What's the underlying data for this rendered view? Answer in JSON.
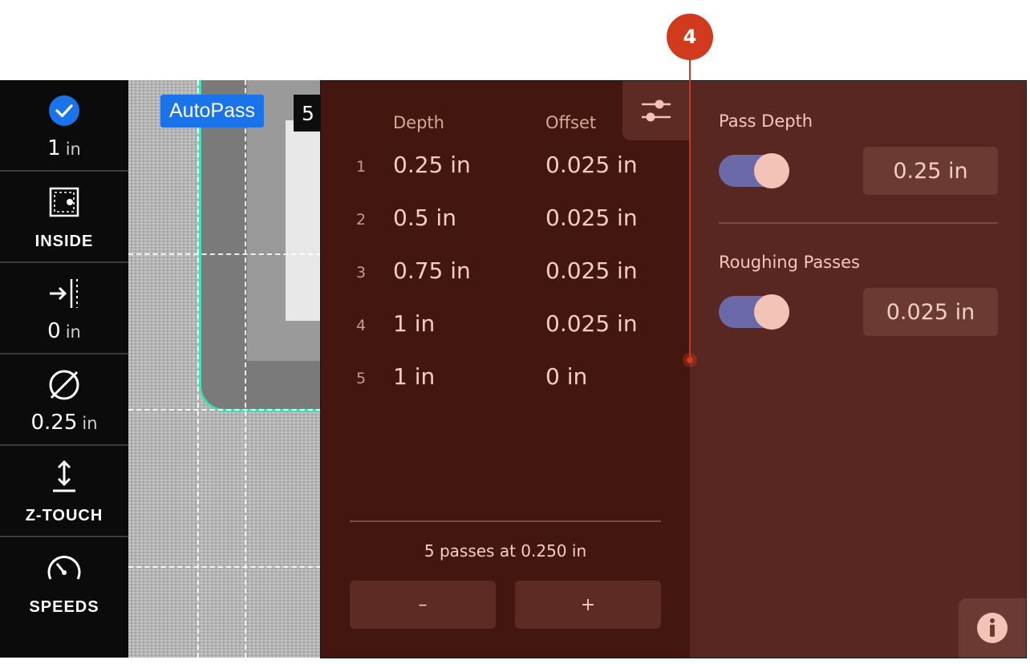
{
  "annotation": {
    "marker": "4"
  },
  "sidebar": {
    "items": [
      {
        "name": "check-status",
        "icon": "check-circle-icon",
        "value": "1",
        "unit": "in"
      },
      {
        "name": "cut-side",
        "icon": "inside-cut-icon",
        "label": "INSIDE"
      },
      {
        "name": "offset",
        "icon": "offset-arrow-icon",
        "value": "0",
        "unit": "in"
      },
      {
        "name": "bit-diameter",
        "icon": "diameter-icon",
        "value": "0.25",
        "unit": "in"
      },
      {
        "name": "z-touch",
        "icon": "z-touch-icon",
        "label": "Z-TOUCH"
      },
      {
        "name": "speeds",
        "icon": "speedometer-icon",
        "label": "SPEEDS"
      }
    ]
  },
  "canvas": {
    "autopass_label": "AutoPass",
    "pass_count": "5"
  },
  "passes": {
    "headers": {
      "depth": "Depth",
      "offset": "Offset"
    },
    "rows": [
      {
        "num": "1",
        "depth": "0.25 in",
        "offset": "0.025 in"
      },
      {
        "num": "2",
        "depth": "0.5 in",
        "offset": "0.025 in"
      },
      {
        "num": "3",
        "depth": "0.75 in",
        "offset": "0.025 in"
      },
      {
        "num": "4",
        "depth": "1 in",
        "offset": "0.025 in"
      },
      {
        "num": "5",
        "depth": "1 in",
        "offset": "0 in"
      }
    ],
    "summary": "5 passes at 0.250 in",
    "minus_label": "–",
    "plus_label": "+"
  },
  "settings": {
    "pass_depth": {
      "label": "Pass Depth",
      "enabled": true,
      "value": "0.25 in"
    },
    "roughing_passes": {
      "label": "Roughing Passes",
      "enabled": true,
      "value": "0.025 in"
    }
  },
  "colors": {
    "left_pane": "#43170f",
    "right_pane": "#582722",
    "toggle_track": "#6b6aa8",
    "toggle_knob": "#f2c3b6",
    "accent_blue": "#1a73e8",
    "path_green": "#3de0b5",
    "callout_red": "#d13a1c"
  }
}
